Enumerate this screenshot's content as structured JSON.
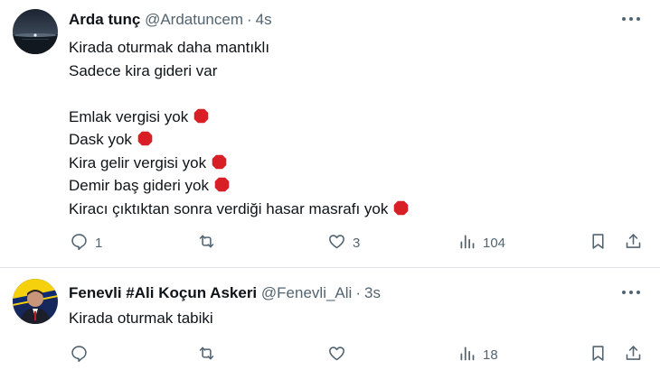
{
  "tweets": [
    {
      "name": "Arda tunç",
      "handle": "@Ardatuncem",
      "separator": "·",
      "time": "4s",
      "lines": [
        {
          "text": "Kirada oturmak daha mantıklı",
          "emoji": false
        },
        {
          "text": "Sadece kira gideri var",
          "emoji": false
        },
        {
          "text": "",
          "emoji": false
        },
        {
          "text": "Emlak vergisi yok",
          "emoji": true
        },
        {
          "text": "Dask yok",
          "emoji": true
        },
        {
          "text": "Kira gelir vergisi yok",
          "emoji": true
        },
        {
          "text": "Demir baş gideri yok",
          "emoji": true
        },
        {
          "text": "Kiracı çıktıktan sonra verdiği hasar masrafı yok",
          "emoji": true
        }
      ],
      "replies": "1",
      "retweets": "",
      "likes": "3",
      "views": "104"
    },
    {
      "name": "Fenevli #Ali Koçun Askeri",
      "handle": "@Fenevli_Ali",
      "separator": "·",
      "time": "3s",
      "lines": [
        {
          "text": "Kirada oturmak tabiki",
          "emoji": false
        }
      ],
      "replies": "",
      "retweets": "",
      "likes": "",
      "views": "18"
    }
  ],
  "icons": {
    "more": "more-horizontal-icon",
    "reply": "reply-icon",
    "retweet": "retweet-icon",
    "like": "heart-icon",
    "views": "views-chart-icon",
    "bookmark": "bookmark-icon",
    "share": "share-icon",
    "stop_emoji": "stop-sign-emoji"
  },
  "colors": {
    "text": "#0f1419",
    "secondary": "#536471",
    "divider": "#dfe3e6",
    "stop_sign": "#d91f26"
  }
}
